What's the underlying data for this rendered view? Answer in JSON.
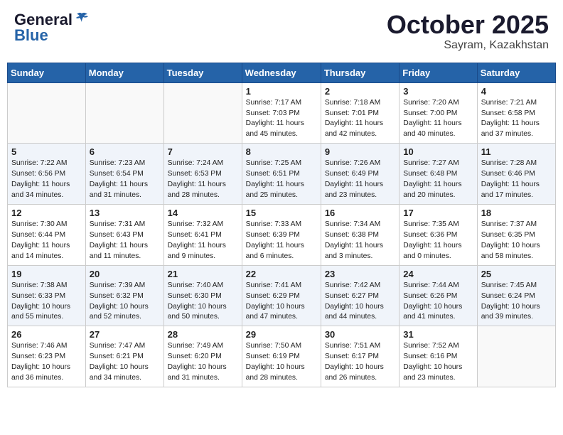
{
  "header": {
    "logo_general": "General",
    "logo_blue": "Blue",
    "month_year": "October 2025",
    "location": "Sayram, Kazakhstan"
  },
  "days_of_week": [
    "Sunday",
    "Monday",
    "Tuesday",
    "Wednesday",
    "Thursday",
    "Friday",
    "Saturday"
  ],
  "weeks": [
    [
      {
        "day": "",
        "content": ""
      },
      {
        "day": "",
        "content": ""
      },
      {
        "day": "",
        "content": ""
      },
      {
        "day": "1",
        "content": "Sunrise: 7:17 AM\nSunset: 7:03 PM\nDaylight: 11 hours\nand 45 minutes."
      },
      {
        "day": "2",
        "content": "Sunrise: 7:18 AM\nSunset: 7:01 PM\nDaylight: 11 hours\nand 42 minutes."
      },
      {
        "day": "3",
        "content": "Sunrise: 7:20 AM\nSunset: 7:00 PM\nDaylight: 11 hours\nand 40 minutes."
      },
      {
        "day": "4",
        "content": "Sunrise: 7:21 AM\nSunset: 6:58 PM\nDaylight: 11 hours\nand 37 minutes."
      }
    ],
    [
      {
        "day": "5",
        "content": "Sunrise: 7:22 AM\nSunset: 6:56 PM\nDaylight: 11 hours\nand 34 minutes."
      },
      {
        "day": "6",
        "content": "Sunrise: 7:23 AM\nSunset: 6:54 PM\nDaylight: 11 hours\nand 31 minutes."
      },
      {
        "day": "7",
        "content": "Sunrise: 7:24 AM\nSunset: 6:53 PM\nDaylight: 11 hours\nand 28 minutes."
      },
      {
        "day": "8",
        "content": "Sunrise: 7:25 AM\nSunset: 6:51 PM\nDaylight: 11 hours\nand 25 minutes."
      },
      {
        "day": "9",
        "content": "Sunrise: 7:26 AM\nSunset: 6:49 PM\nDaylight: 11 hours\nand 23 minutes."
      },
      {
        "day": "10",
        "content": "Sunrise: 7:27 AM\nSunset: 6:48 PM\nDaylight: 11 hours\nand 20 minutes."
      },
      {
        "day": "11",
        "content": "Sunrise: 7:28 AM\nSunset: 6:46 PM\nDaylight: 11 hours\nand 17 minutes."
      }
    ],
    [
      {
        "day": "12",
        "content": "Sunrise: 7:30 AM\nSunset: 6:44 PM\nDaylight: 11 hours\nand 14 minutes."
      },
      {
        "day": "13",
        "content": "Sunrise: 7:31 AM\nSunset: 6:43 PM\nDaylight: 11 hours\nand 11 minutes."
      },
      {
        "day": "14",
        "content": "Sunrise: 7:32 AM\nSunset: 6:41 PM\nDaylight: 11 hours\nand 9 minutes."
      },
      {
        "day": "15",
        "content": "Sunrise: 7:33 AM\nSunset: 6:39 PM\nDaylight: 11 hours\nand 6 minutes."
      },
      {
        "day": "16",
        "content": "Sunrise: 7:34 AM\nSunset: 6:38 PM\nDaylight: 11 hours\nand 3 minutes."
      },
      {
        "day": "17",
        "content": "Sunrise: 7:35 AM\nSunset: 6:36 PM\nDaylight: 11 hours\nand 0 minutes."
      },
      {
        "day": "18",
        "content": "Sunrise: 7:37 AM\nSunset: 6:35 PM\nDaylight: 10 hours\nand 58 minutes."
      }
    ],
    [
      {
        "day": "19",
        "content": "Sunrise: 7:38 AM\nSunset: 6:33 PM\nDaylight: 10 hours\nand 55 minutes."
      },
      {
        "day": "20",
        "content": "Sunrise: 7:39 AM\nSunset: 6:32 PM\nDaylight: 10 hours\nand 52 minutes."
      },
      {
        "day": "21",
        "content": "Sunrise: 7:40 AM\nSunset: 6:30 PM\nDaylight: 10 hours\nand 50 minutes."
      },
      {
        "day": "22",
        "content": "Sunrise: 7:41 AM\nSunset: 6:29 PM\nDaylight: 10 hours\nand 47 minutes."
      },
      {
        "day": "23",
        "content": "Sunrise: 7:42 AM\nSunset: 6:27 PM\nDaylight: 10 hours\nand 44 minutes."
      },
      {
        "day": "24",
        "content": "Sunrise: 7:44 AM\nSunset: 6:26 PM\nDaylight: 10 hours\nand 41 minutes."
      },
      {
        "day": "25",
        "content": "Sunrise: 7:45 AM\nSunset: 6:24 PM\nDaylight: 10 hours\nand 39 minutes."
      }
    ],
    [
      {
        "day": "26",
        "content": "Sunrise: 7:46 AM\nSunset: 6:23 PM\nDaylight: 10 hours\nand 36 minutes."
      },
      {
        "day": "27",
        "content": "Sunrise: 7:47 AM\nSunset: 6:21 PM\nDaylight: 10 hours\nand 34 minutes."
      },
      {
        "day": "28",
        "content": "Sunrise: 7:49 AM\nSunset: 6:20 PM\nDaylight: 10 hours\nand 31 minutes."
      },
      {
        "day": "29",
        "content": "Sunrise: 7:50 AM\nSunset: 6:19 PM\nDaylight: 10 hours\nand 28 minutes."
      },
      {
        "day": "30",
        "content": "Sunrise: 7:51 AM\nSunset: 6:17 PM\nDaylight: 10 hours\nand 26 minutes."
      },
      {
        "day": "31",
        "content": "Sunrise: 7:52 AM\nSunset: 6:16 PM\nDaylight: 10 hours\nand 23 minutes."
      },
      {
        "day": "",
        "content": ""
      }
    ]
  ]
}
